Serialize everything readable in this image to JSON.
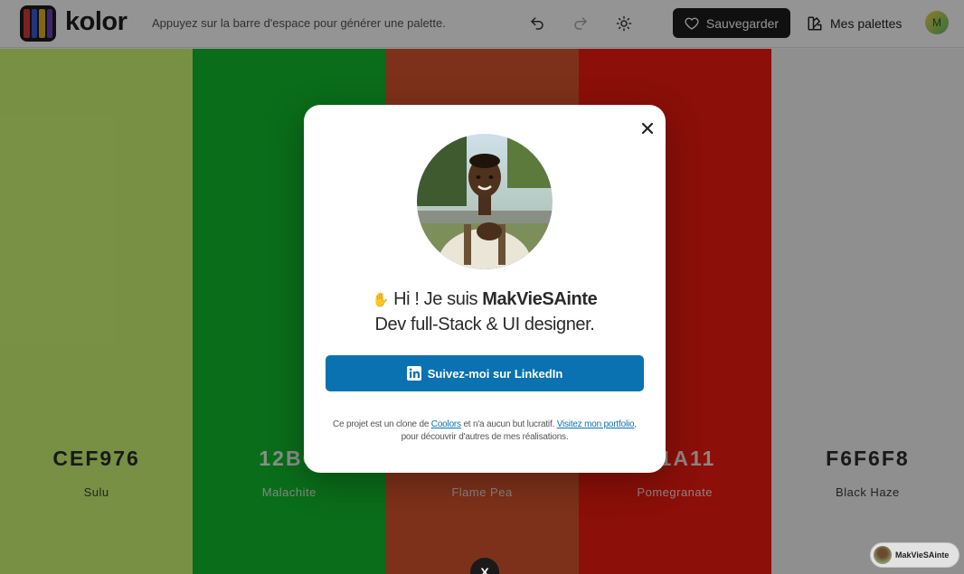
{
  "header": {
    "logo_text": "kolor",
    "logo_colors": [
      "#d23b3b",
      "#3c5bd6",
      "#e0b022",
      "#6e3ec7"
    ],
    "hint": "Appuyez sur la barre d'espace pour générer une palette.",
    "undo_icon": "undo-icon",
    "redo_icon": "redo-icon",
    "theme_icon": "sun-icon",
    "save_label": "Sauvegarder",
    "palettes_label": "Mes palettes",
    "avatar_letter": "M"
  },
  "palette": [
    {
      "hex": "CEF976",
      "name": "Sulu",
      "color": "#CEF976",
      "text_color": "#2b2b2b"
    },
    {
      "hex": "12BC",
      "name": "Malachite",
      "color": "#12BC2E",
      "text_color": "#ffffff"
    },
    {
      "hex": "",
      "name": "Flame Pea",
      "color": "#D9552E",
      "text_color": "#ffffff"
    },
    {
      "hex": "1A11",
      "name": "Pomegranate",
      "color": "#F21A11",
      "text_color": "#ffffff"
    },
    {
      "hex": "F6F6F8",
      "name": "Black Haze",
      "color": "#F6F6F8",
      "text_color": "#2b2b2b"
    }
  ],
  "modal": {
    "wave_icon": "waving-hand-icon",
    "greeting_prefix": "Hi ! Je suis ",
    "name": "MakVieSAinte",
    "role": "Dev full-Stack & UI designer.",
    "linkedin_label": "Suivez-moi sur LinkedIn",
    "footnote_1": "Ce projet est un clone de ",
    "footnote_link_1": "Coolors",
    "footnote_2": " et n'a aucun but lucratif. ",
    "footnote_link_2": "Visitez mon portfolio",
    "footnote_3": ", pour découvrir d'autres de mes réalisations."
  },
  "bottom": {
    "x_label": "X",
    "chip_label": "MakVieSAinte"
  }
}
